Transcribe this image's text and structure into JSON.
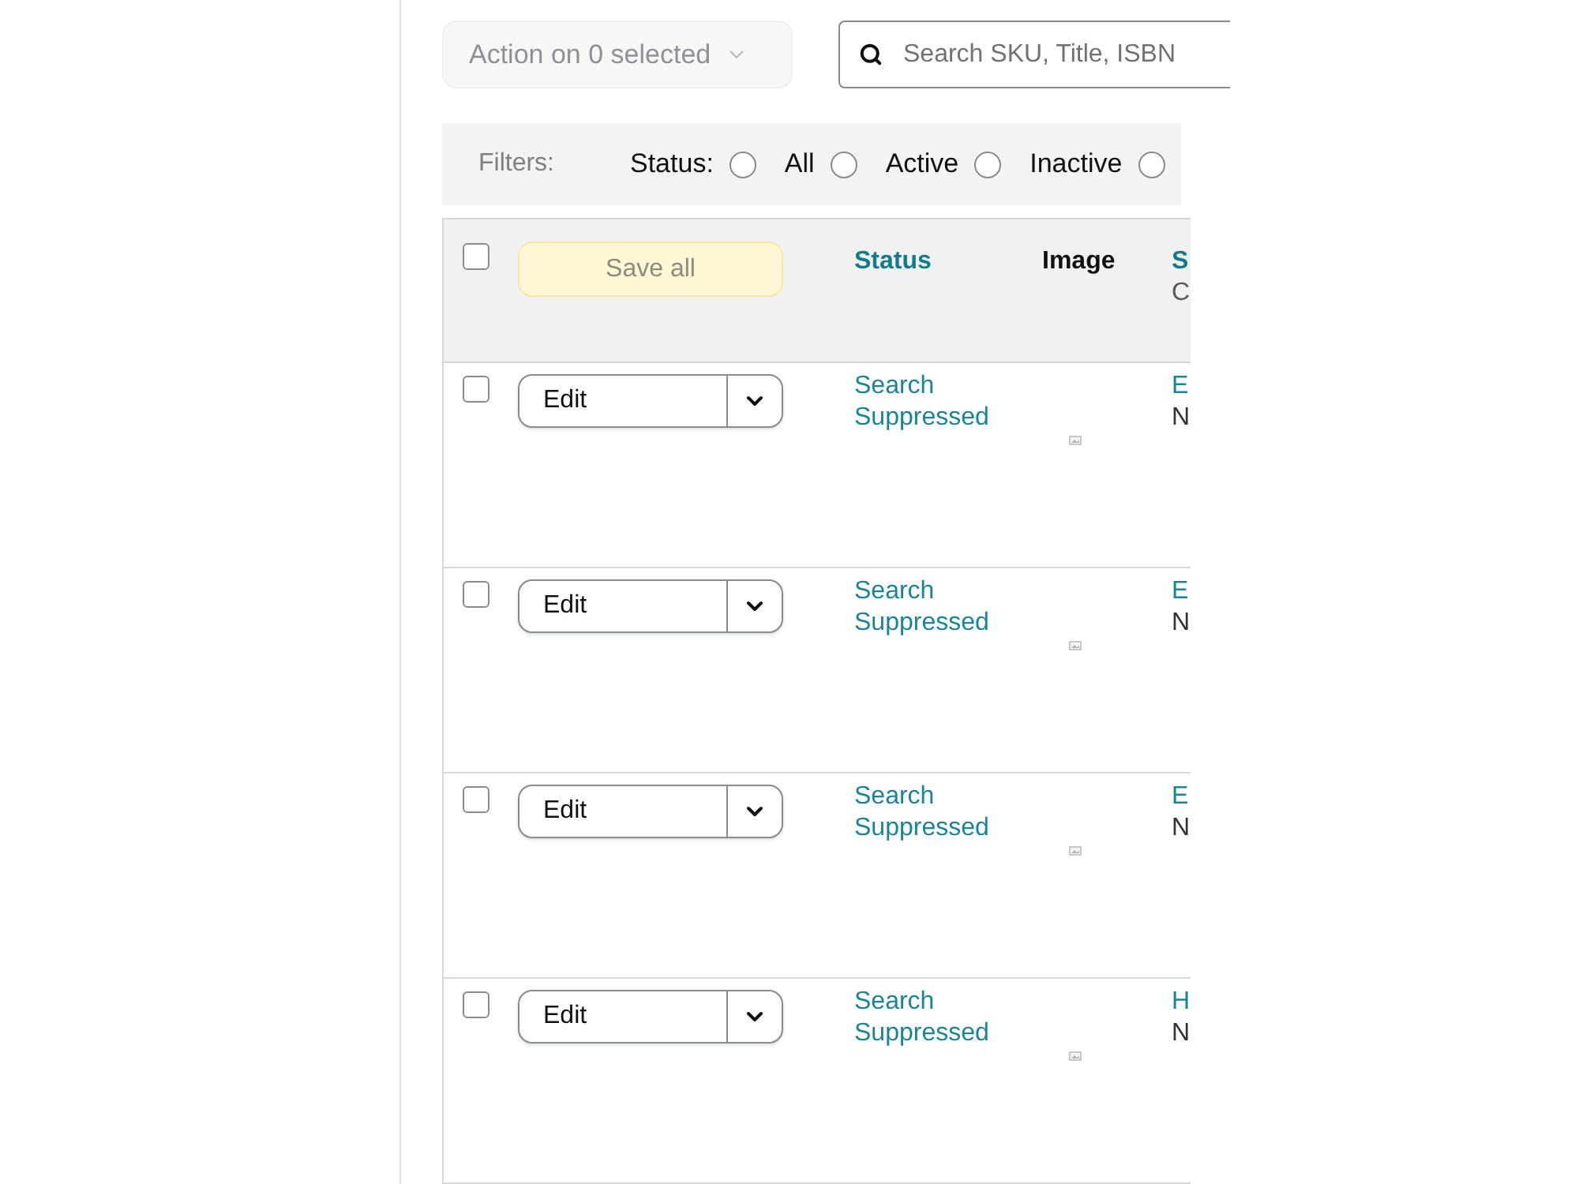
{
  "toolbar": {
    "action_dropdown": {
      "label": "Action on 0 selected",
      "disabled": true
    },
    "search": {
      "placeholder": "Search SKU, Title, ISBN"
    }
  },
  "filters": {
    "label": "Filters:",
    "groups": [
      {
        "label": "Status:",
        "options": [
          {
            "label": "All",
            "selected": false
          },
          {
            "label": "Active",
            "selected": false
          },
          {
            "label": "Inactive",
            "selected": false
          },
          {
            "selected": false
          }
        ]
      }
    ]
  },
  "table": {
    "header": {
      "checked": false,
      "save_button": {
        "label": "Save all",
        "disabled": true
      },
      "columns": [
        {
          "kind": "link",
          "label": "Status"
        },
        {
          "kind": "plain",
          "label": "Image"
        },
        {
          "kind": "link",
          "label": "S",
          "sublabel": "C"
        }
      ]
    },
    "rows": [
      {
        "checked": false,
        "action": "Edit",
        "status": "Search Suppressed",
        "column_3": {
          "line_1": "E",
          "line_2": "N"
        }
      },
      {
        "checked": false,
        "action": "Edit",
        "status": "Search Suppressed",
        "column_3": {
          "line_1": "E",
          "line_2": "N"
        }
      },
      {
        "checked": false,
        "action": "Edit",
        "status": "Search Suppressed",
        "column_3": {
          "line_1": "E",
          "line_2": "N"
        }
      },
      {
        "checked": false,
        "action": "Edit",
        "status": "Search Suppressed",
        "column_3": {
          "line_1": "H",
          "line_2": "N"
        }
      }
    ]
  }
}
